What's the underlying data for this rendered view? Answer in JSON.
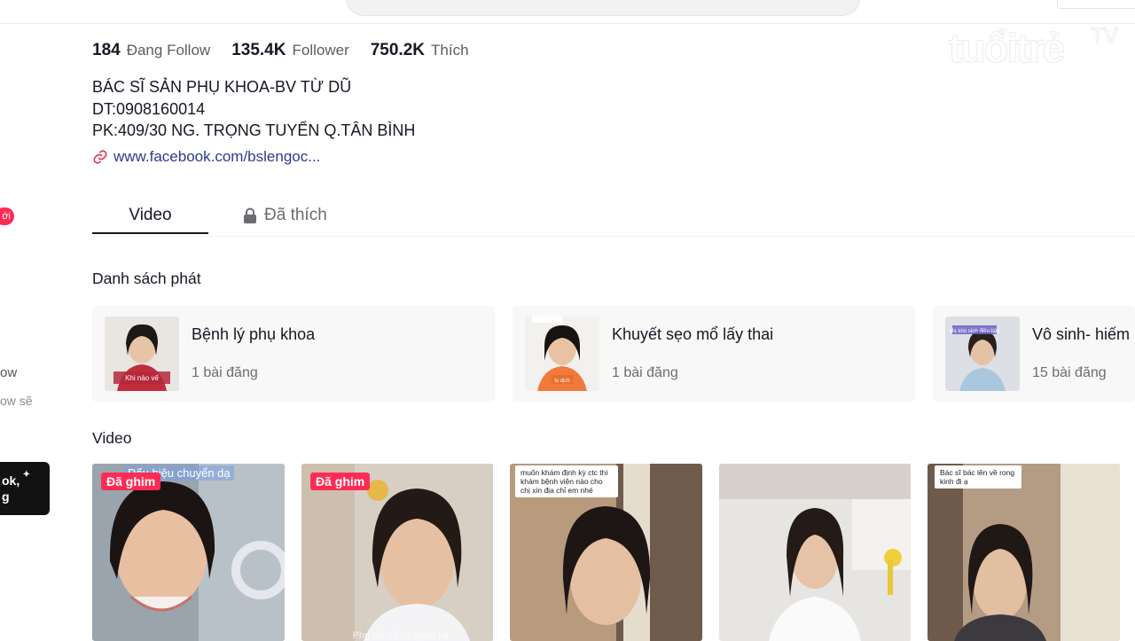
{
  "watermark": {
    "text": "tuổi trẻ TV"
  },
  "left_sidebar": {
    "badge": "ới",
    "text1": "ow",
    "text2": "ow sẽ",
    "card_line1": "ok,",
    "card_line2": "g"
  },
  "stats": [
    {
      "value": "184",
      "label": "Đang Follow"
    },
    {
      "value": "135.4K",
      "label": "Follower"
    },
    {
      "value": "750.2K",
      "label": "Thích"
    }
  ],
  "bio": {
    "line1": "BÁC SĨ SẢN PHỤ KHOA-BV TỪ DŨ",
    "line2": "DT:0908160014",
    "line3": "PK:409/30 NG. TRỌNG TUYỂN Q.TÂN BÌNH",
    "link": "www.facebook.com/bslengoc..."
  },
  "tabs": {
    "video": "Video",
    "liked": "Đã thích"
  },
  "playlists_title": "Danh sách phát",
  "playlists": [
    {
      "title": "Bệnh lý phụ khoa",
      "count": "1 bài đăng",
      "thumb_caption": "Khi nào vế"
    },
    {
      "title": "Khuyết sẹo mổ lấy thai",
      "count": "1 bài đăng",
      "thumb_caption": "lo dịch"
    },
    {
      "title": "Vô sinh- hiếm",
      "count": "15 bài đăng",
      "thumb_caption": "Mẹ khó sinh điều bận"
    }
  ],
  "videos_title": "Video",
  "videos": [
    {
      "pinned": "Đã ghim",
      "caption": "Dấu hiệu chuyển dạ",
      "sticker": ""
    },
    {
      "pinned": "Đã ghim",
      "caption": "",
      "sticker": "",
      "bottom": "Phụ nữ đã có quan hệ"
    },
    {
      "pinned": "",
      "caption": "",
      "sticker": "muốn khám định kỳ ctc thì khám bệnh viện nào cho chị xin địa chỉ em nhé"
    },
    {
      "pinned": "",
      "caption": "",
      "sticker": ""
    },
    {
      "pinned": "",
      "caption": "",
      "sticker": "Bác sĩ bác lên về rong kinh đi ạ"
    }
  ],
  "colors": {
    "accent": "#fe2c55",
    "link": "#2b3a8f"
  }
}
